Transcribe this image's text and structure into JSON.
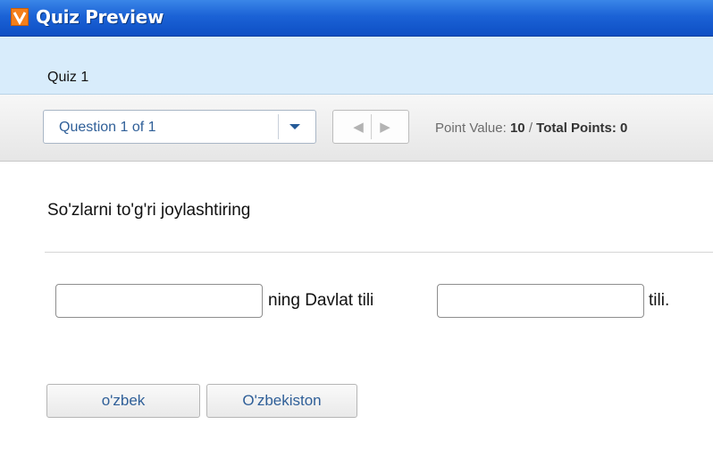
{
  "window": {
    "title": "Quiz Preview",
    "app_icon": "orange-v-icon",
    "title_bar_color": "#1b62d6"
  },
  "quiz": {
    "name": "Quiz 1"
  },
  "toolbar": {
    "question_select_value": "Question 1 of 1",
    "prev_icon": "triangle-left-icon",
    "next_icon": "triangle-right-icon",
    "prev_glyph": "◀",
    "next_glyph": "▶",
    "point_value_label": "Point Value:",
    "point_value": "10",
    "separator": "/",
    "total_points_label": "Total Points:",
    "total_points": "0"
  },
  "question": {
    "instruction": "So'zlarni to'g'ri joylashtiring",
    "blank_1_value": "",
    "middle_text": "ning Davlat tili",
    "blank_2_value": "",
    "end_text": "tili."
  },
  "word_bank": [
    "o'zbek",
    "O'zbekiston"
  ],
  "colors": {
    "accent_blue": "#2f5f98",
    "quiz_header_bg": "#d8ecfb"
  }
}
